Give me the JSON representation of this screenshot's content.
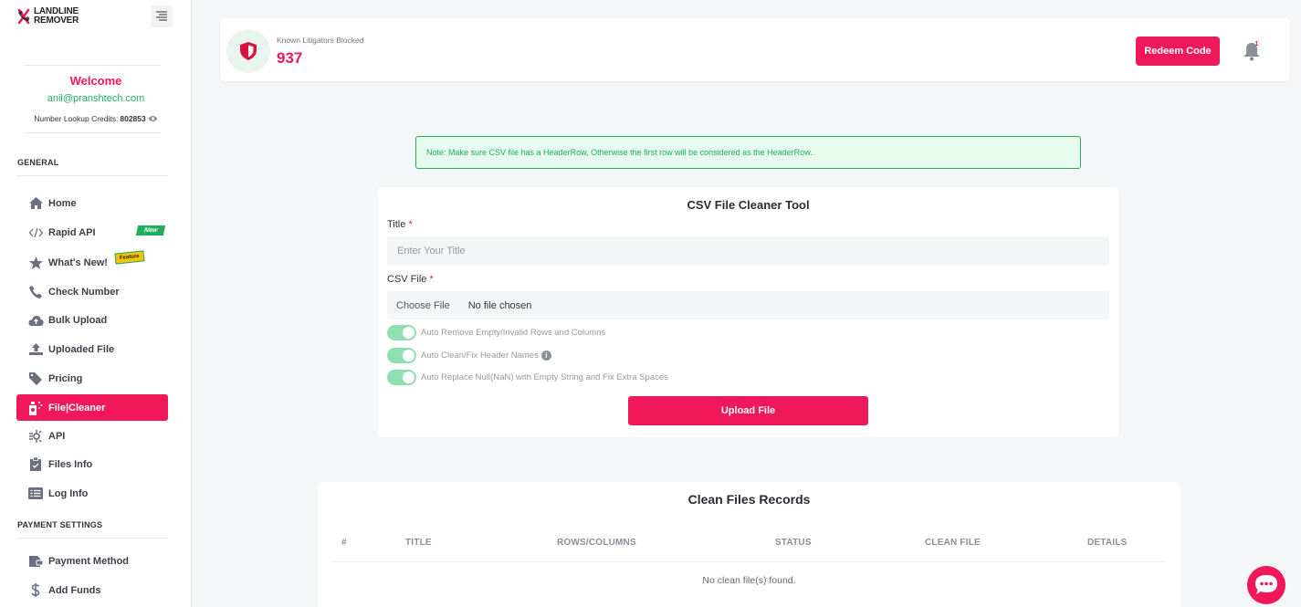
{
  "brand": {
    "line1": "LANDLINE",
    "line2": "REMOVER",
    "accent": "#f0185a"
  },
  "welcome": {
    "title": "Welcome",
    "email": "anil@pranshtech.com",
    "credits_label": "Number Lookup Credits:",
    "credits_value": "802853"
  },
  "sections": {
    "general": "GENERAL",
    "payment": "PAYMENT SETTINGS"
  },
  "nav": [
    {
      "label": "Home",
      "icon": "home-icon"
    },
    {
      "label": "Rapid API",
      "icon": "code-icon",
      "badge": "New"
    },
    {
      "label": "What's New!",
      "icon": "star-icon",
      "badge": "Feature"
    },
    {
      "label": "Check Number",
      "icon": "phone-icon"
    },
    {
      "label": "Bulk Upload",
      "icon": "cloud-upload-icon"
    },
    {
      "label": "Uploaded File",
      "icon": "upload-icon"
    },
    {
      "label": "Pricing",
      "icon": "tag-icon"
    },
    {
      "label": "File|Cleaner",
      "icon": "file-cleaner-icon",
      "active": true
    },
    {
      "label": "API",
      "icon": "api-icon"
    },
    {
      "label": "Files Info",
      "icon": "clipboard-icon"
    },
    {
      "label": "Log Info",
      "icon": "list-icon"
    }
  ],
  "payment_nav": [
    {
      "label": "Payment Method",
      "icon": "card-icon"
    },
    {
      "label": "Add Funds",
      "icon": "dollar-icon"
    }
  ],
  "header": {
    "litigators_label": "Known Litigators Blocked",
    "litigators_value": "937",
    "redeem_label": "Redeem Code",
    "bell_count": "1"
  },
  "note": "Note: Make sure CSV file has a HeaderRow, Otherwise the first row will be considered as the HeaderRow.",
  "form": {
    "title": "CSV File Cleaner Tool",
    "title_label": "Title",
    "title_placeholder": "Enter Your Title",
    "csv_label": "CSV File",
    "required_mark": "*",
    "file_button": "Choose File",
    "file_status": "No file chosen",
    "toggles": [
      {
        "label": "Auto Remove Empty/Invalid Rows and Columns",
        "on": true
      },
      {
        "label": "Auto Clean/Fix Header Names",
        "on": true,
        "info": "i"
      },
      {
        "label": "Auto Replace Null(NaN) with Empty String and Fix Extra Spaces",
        "on": true
      }
    ],
    "upload_label": "Upload File"
  },
  "records": {
    "title": "Clean Files Records",
    "columns": [
      "#",
      "TITLE",
      "ROWS/COLUMNS",
      "STATUS",
      "CLEAN FILE",
      "DETAILS"
    ],
    "empty": "No clean file(s) found."
  }
}
